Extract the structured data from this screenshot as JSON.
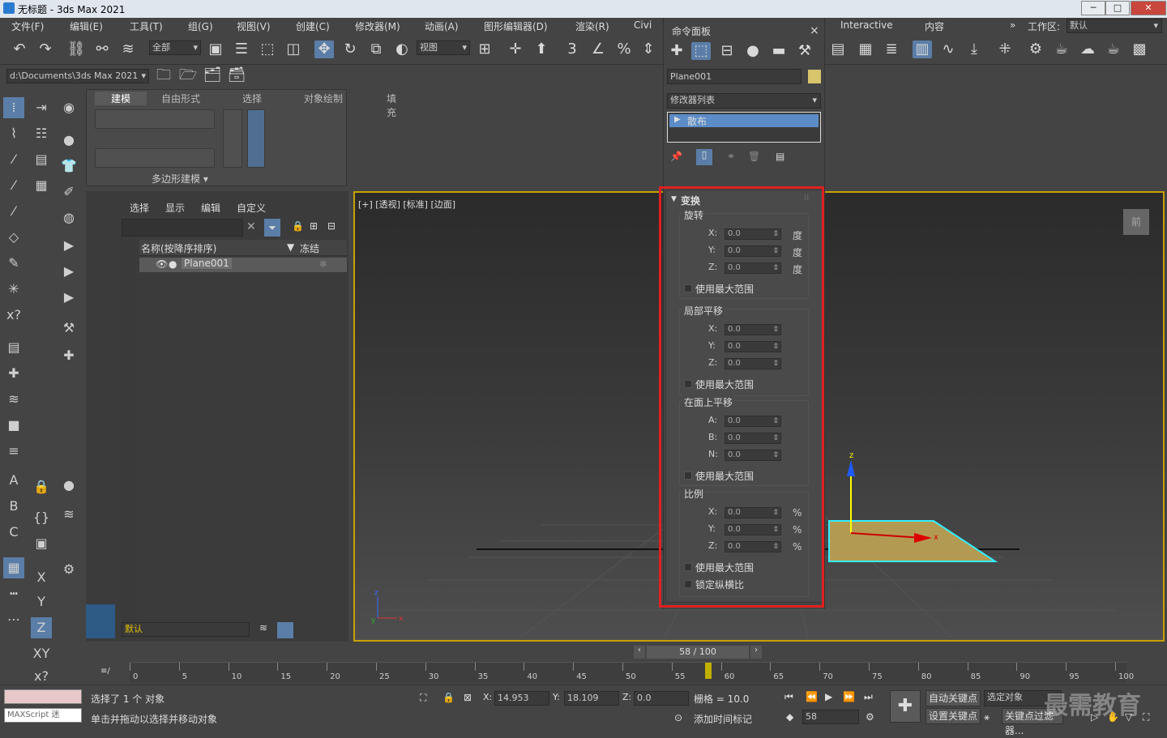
{
  "window": {
    "title": "无标题 - 3ds Max 2021",
    "min": "─",
    "max": "□",
    "close": "✕"
  },
  "menu": [
    "文件(F)",
    "编辑(E)",
    "工具(T)",
    "组(G)",
    "视图(V)",
    "创建(C)",
    "修改器(M)",
    "动画(A)",
    "图形编辑器(D)",
    "渲染(R)",
    "Civi"
  ],
  "menu_right": {
    "interactive": "Interactive",
    "content": "内容",
    "workspace_label": "工作区:",
    "workspace_value": "默认",
    "more": "»"
  },
  "toolbar": {
    "selection_filter": "全部",
    "view_dropdown": "视图",
    "path": "d:\\Documents\\3ds Max 2021"
  },
  "ribbon": {
    "tabs": [
      "建模",
      "自由形式",
      "选择",
      "对象绘制",
      "填充"
    ],
    "panel_label": "多边形建模 ▾"
  },
  "scene_explorer": {
    "menus": [
      "选择",
      "显示",
      "编辑",
      "自定义"
    ],
    "col_name": "名称(按降序排序)",
    "col_freeze": "冻结",
    "rows": [
      {
        "name": "Plane001"
      }
    ],
    "layer": "默认"
  },
  "viewport": {
    "label": "[+] [透视] [标准] [边面]",
    "corner_label": "前",
    "axis_z": "z",
    "axis_x": "x",
    "axis_y": "y"
  },
  "command_panel": {
    "title": "命令面板",
    "close": "×",
    "object_name": "Plane001",
    "object_color": "#d7c46b",
    "modifier_list": "修改器列表",
    "stack_item": "散布",
    "rollout_title": "变换",
    "groups": [
      {
        "label": "旋转",
        "fields": [
          {
            "axis": "X:",
            "value": "0.0",
            "unit": "度"
          },
          {
            "axis": "Y:",
            "value": "0.0",
            "unit": "度"
          },
          {
            "axis": "Z:",
            "value": "0.0",
            "unit": "度"
          }
        ],
        "checks": [
          "使用最大范围"
        ]
      },
      {
        "label": "局部平移",
        "fields": [
          {
            "axis": "X:",
            "value": "0.0",
            "unit": ""
          },
          {
            "axis": "Y:",
            "value": "0.0",
            "unit": ""
          },
          {
            "axis": "Z:",
            "value": "0.0",
            "unit": ""
          }
        ],
        "checks": [
          "使用最大范围"
        ]
      },
      {
        "label": "在面上平移",
        "fields": [
          {
            "axis": "A:",
            "value": "0.0",
            "unit": ""
          },
          {
            "axis": "B:",
            "value": "0.0",
            "unit": ""
          },
          {
            "axis": "N:",
            "value": "0.0",
            "unit": ""
          }
        ],
        "checks": [
          "使用最大范围"
        ]
      },
      {
        "label": "比例",
        "fields": [
          {
            "axis": "X:",
            "value": "0.0",
            "unit": "%"
          },
          {
            "axis": "Y:",
            "value": "0.0",
            "unit": "%"
          },
          {
            "axis": "Z:",
            "value": "0.0",
            "unit": "%"
          }
        ],
        "checks": [
          "使用最大范围",
          "锁定纵横比"
        ]
      }
    ]
  },
  "timeline": {
    "frame": "58 / 100",
    "ticks": [
      "0",
      "5",
      "10",
      "15",
      "20",
      "25",
      "30",
      "35",
      "40",
      "45",
      "50",
      "55",
      "60",
      "65",
      "70",
      "75",
      "80",
      "85",
      "90",
      "95",
      "100"
    ]
  },
  "status": {
    "maxscript": "MAXScript 迷",
    "selected": "选择了 1 个 对象",
    "hint": "单击并拖动以选择并移动对象",
    "x_label": "X:",
    "x": "14.953",
    "y_label": "Y:",
    "y": "18.109",
    "z_label": "Z:",
    "z": "0.0",
    "grid": "栅格 = 10.0",
    "add_time_tag": "添加时间标记",
    "auto_key": "自动关键点",
    "set_key": "设置关键点",
    "selected_object": "选定对象",
    "key_filter": "关键点过滤器...",
    "frame_field": "58",
    "watermark": "最需教育"
  }
}
